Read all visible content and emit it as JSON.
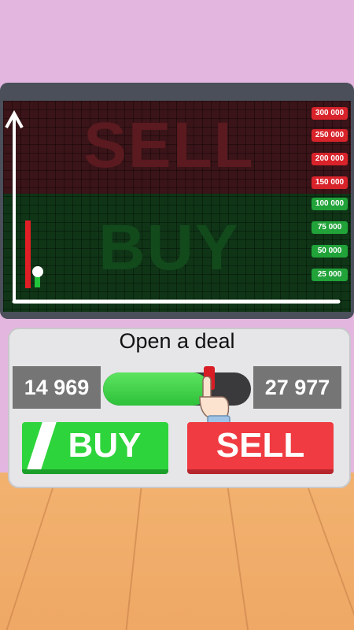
{
  "screen": {
    "sell_label": "SELL",
    "buy_label": "BUY",
    "price_levels": [
      {
        "label": "300 000",
        "color": "red"
      },
      {
        "label": "250 000",
        "color": "red"
      },
      {
        "label": "200 000",
        "color": "red"
      },
      {
        "label": "150 000",
        "color": "red"
      },
      {
        "label": "100 000",
        "color": "green"
      },
      {
        "label": "75 000",
        "color": "green"
      },
      {
        "label": "50 000",
        "color": "green"
      },
      {
        "label": "25 000",
        "color": "green"
      }
    ]
  },
  "deal": {
    "title": "Open a deal",
    "min_value": "14 969",
    "max_value": "27 977",
    "slider_fraction": 0.72,
    "buy_label": "BUY",
    "sell_label": "SELL"
  },
  "colors": {
    "buy": "#2ed43c",
    "sell": "#ef3b41"
  }
}
